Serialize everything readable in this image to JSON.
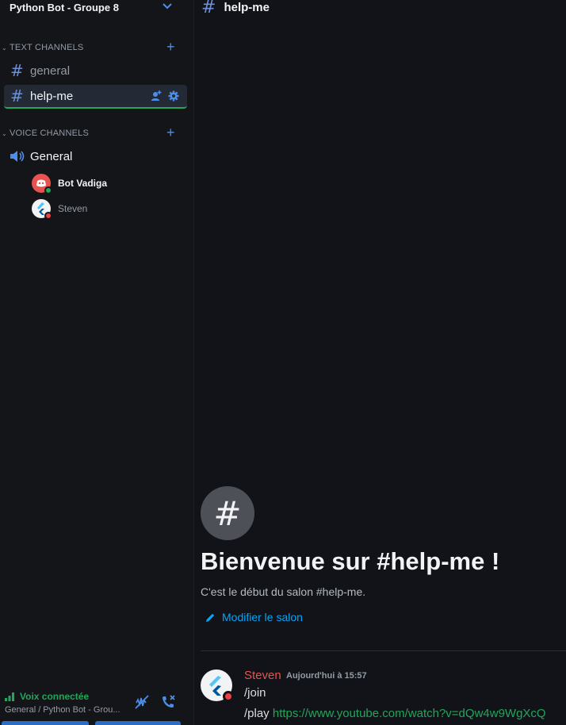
{
  "server": {
    "name": "Python Bot - Groupe 8"
  },
  "categories": {
    "text": {
      "label": "TEXT CHANNELS"
    },
    "voice": {
      "label": "VOICE CHANNELS"
    }
  },
  "text_channels": [
    {
      "name": "general",
      "active": false
    },
    {
      "name": "help-me",
      "active": true
    }
  ],
  "voice_channel": {
    "name": "General",
    "users": [
      {
        "name": "Bot Vadiga",
        "status": "online",
        "status_color": "#23a55a"
      },
      {
        "name": "Steven",
        "status": "dnd",
        "status_color": "#f23f43"
      }
    ]
  },
  "voice_status": {
    "title": "Voix connectée",
    "subtitle": "General / Python Bot - Grou..."
  },
  "main": {
    "channel_title": "help-me",
    "welcome_title": "Bienvenue sur #help-me !",
    "welcome_sub": "C'est le début du salon #help-me.",
    "edit_label": "Modifier le salon"
  },
  "message": {
    "author": "Steven",
    "time": "Aujourd'hui à 15:57",
    "line1": "/join",
    "line2_prefix": "/play ",
    "line2_link": "https://www.youtube.com/watch?v=dQw4w9WgXcQ"
  },
  "colors": {
    "accent": "#4f8ee8",
    "online": "#23a55a",
    "dnd": "#f23f43",
    "link": "#00a8fc"
  },
  "icons": {
    "server_chevron": "chevron-down-icon",
    "text_channel": "hash-icon",
    "voice_channel": "speaker-icon",
    "add": "plus-icon",
    "invite": "add-user-icon",
    "settings": "gear-icon",
    "signal": "signal-icon",
    "noise_suppression": "noise-suppression-icon",
    "disconnect": "phone-disconnect-icon",
    "edit": "pencil-icon"
  }
}
